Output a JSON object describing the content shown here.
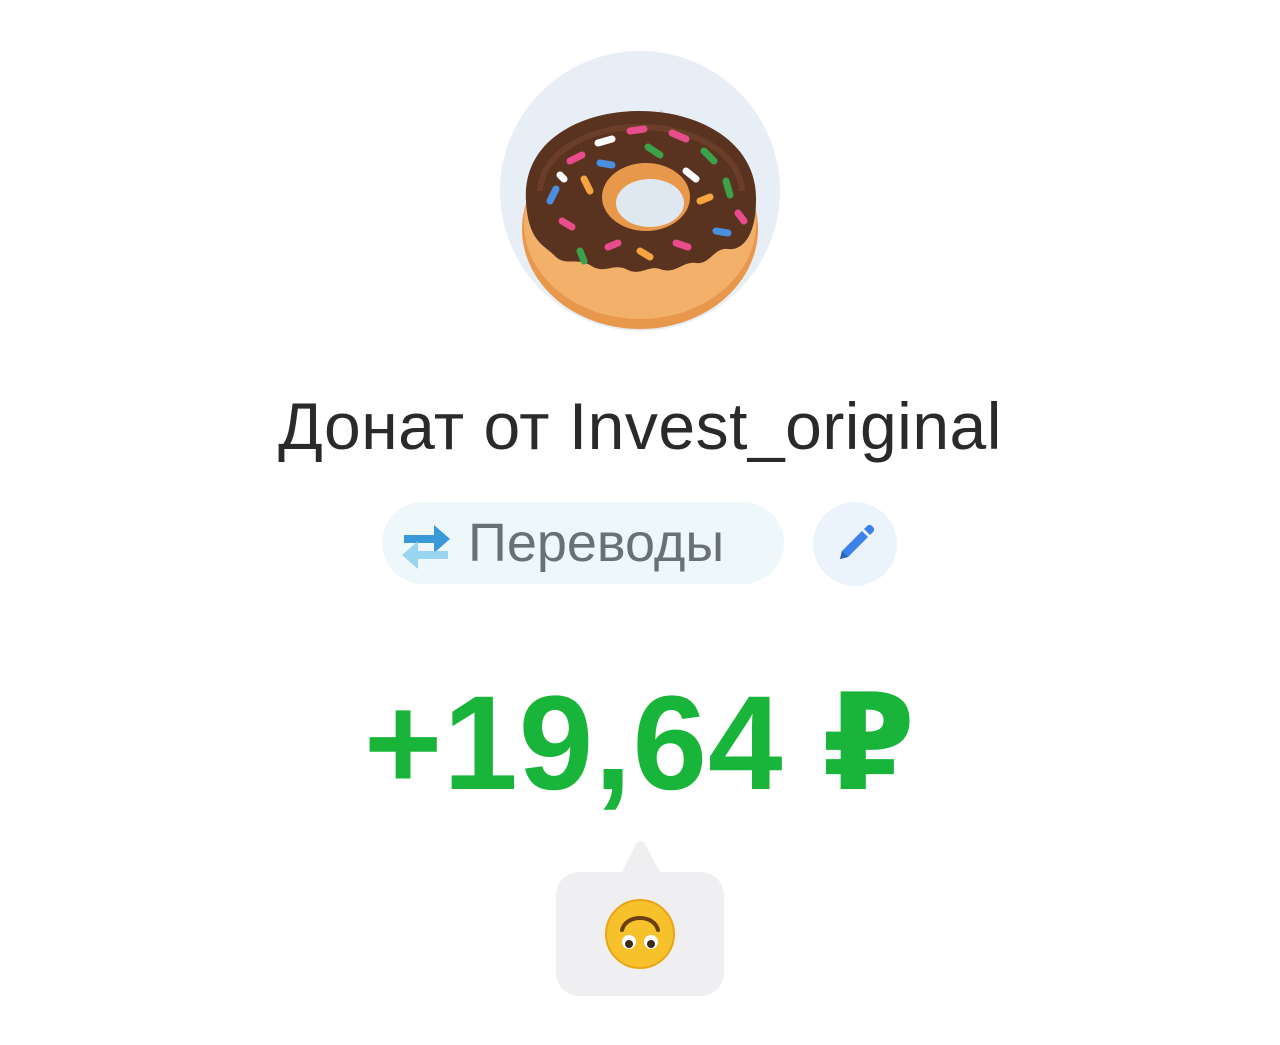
{
  "transaction": {
    "title": "Донат от Invest_original",
    "category_label": "Переводы",
    "amount": "+19,64 ₽",
    "amount_color": "#19b53a"
  },
  "icons": {
    "avatar": "donut-icon",
    "category": "transfer-arrows-icon",
    "edit": "pencil-icon",
    "reaction": "upside-down-face-emoji"
  }
}
